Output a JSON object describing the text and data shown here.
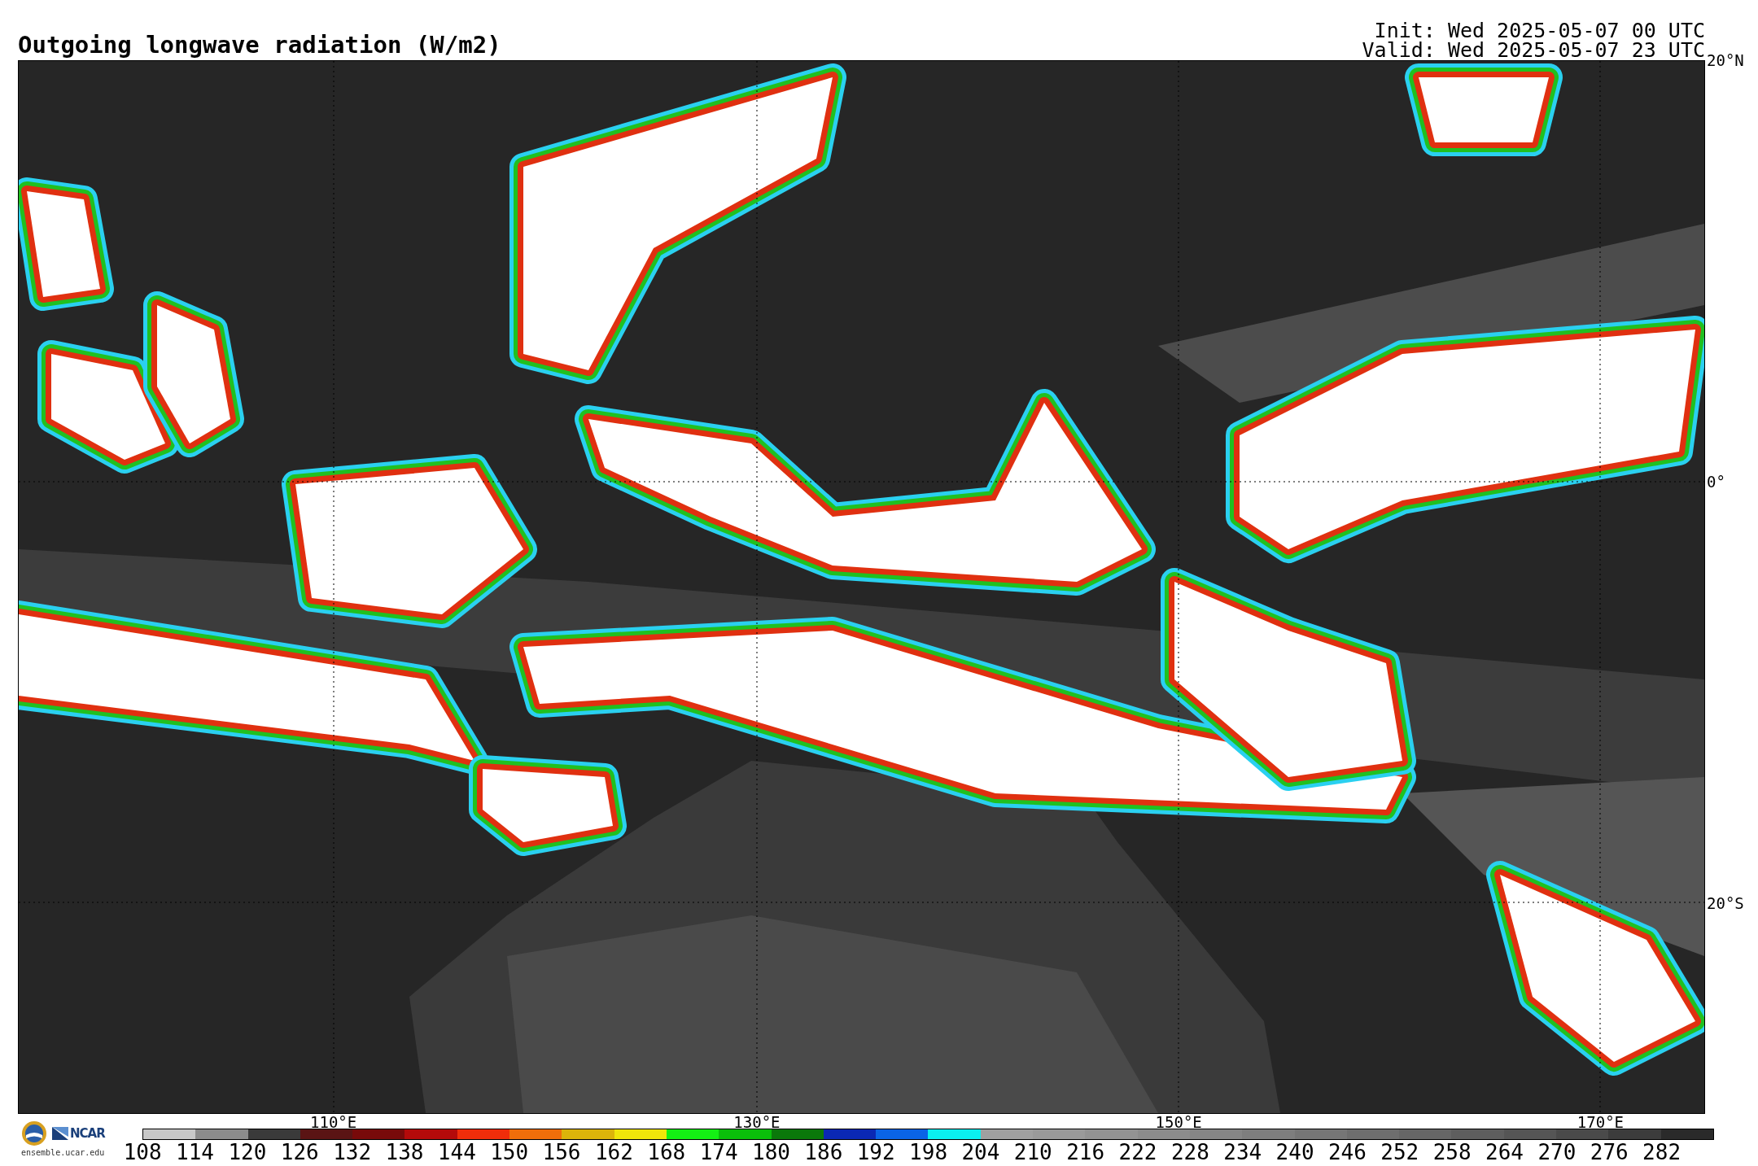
{
  "title": "Outgoing longwave radiation (W/m2)",
  "init": "Init: Wed 2025-05-07 00 UTC",
  "valid": "Valid: Wed 2025-05-07 23 UTC",
  "map": {
    "lat_labels": [
      "20°N",
      "0°",
      "20°S"
    ],
    "lon_labels": [
      "110°E",
      "130°E",
      "150°E",
      "170°E"
    ]
  },
  "logo": {
    "name": "NCAR",
    "site": "ensemble.ucar.edu"
  },
  "colorbar": [
    {
      "label": "108",
      "color": "#c8c8c8"
    },
    {
      "label": "114",
      "color": "#8c8c8c"
    },
    {
      "label": "120",
      "color": "#3a3a3a"
    },
    {
      "label": "126",
      "color": "#5a1414"
    },
    {
      "label": "132",
      "color": "#780a0a"
    },
    {
      "label": "138",
      "color": "#b40a0a"
    },
    {
      "label": "144",
      "color": "#f02d0a"
    },
    {
      "label": "150",
      "color": "#f06e0a"
    },
    {
      "label": "156",
      "color": "#dcb40a"
    },
    {
      "label": "162",
      "color": "#f0e60a"
    },
    {
      "label": "168",
      "color": "#14f014"
    },
    {
      "label": "174",
      "color": "#0abe0a"
    },
    {
      "label": "180",
      "color": "#0a780a"
    },
    {
      "label": "186",
      "color": "#0a28b4"
    },
    {
      "label": "192",
      "color": "#0a64e6"
    },
    {
      "label": "198",
      "color": "#0af0f0"
    },
    {
      "label": "204",
      "color": "#a0a0a0"
    },
    {
      "label": "210",
      "color": "#9a9a9a"
    },
    {
      "label": "216",
      "color": "#939393"
    },
    {
      "label": "222",
      "color": "#8c8c8c"
    },
    {
      "label": "228",
      "color": "#858585"
    },
    {
      "label": "234",
      "color": "#7e7e7e"
    },
    {
      "label": "240",
      "color": "#767676"
    },
    {
      "label": "246",
      "color": "#6e6e6e"
    },
    {
      "label": "252",
      "color": "#666666"
    },
    {
      "label": "258",
      "color": "#5e5e5e"
    },
    {
      "label": "264",
      "color": "#555555"
    },
    {
      "label": "270",
      "color": "#4a4a4a"
    },
    {
      "label": "276",
      "color": "#3c3c3c"
    },
    {
      "label": "282",
      "color": "#2a2a2a"
    }
  ]
}
